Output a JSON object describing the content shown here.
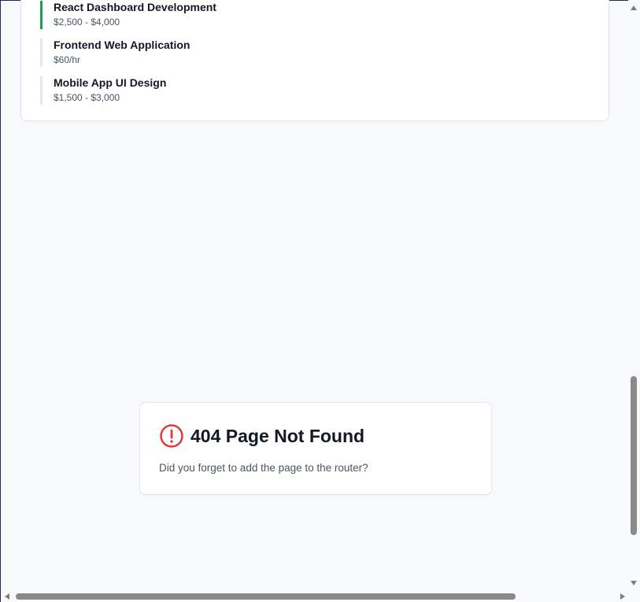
{
  "jobs": {
    "items": [
      {
        "title": "React Dashboard Development",
        "rate": "$2,500 - $4,000"
      },
      {
        "title": "Frontend Web Application",
        "rate": "$60/hr"
      },
      {
        "title": "Mobile App UI Design",
        "rate": "$1,500 - $3,000"
      }
    ],
    "active_accent": "#16a34a"
  },
  "not_found": {
    "icon": "alert-circle-icon",
    "icon_color": "#dc3b3b",
    "title": "404 Page Not Found",
    "message": "Did you forget to add the page to the router?"
  }
}
